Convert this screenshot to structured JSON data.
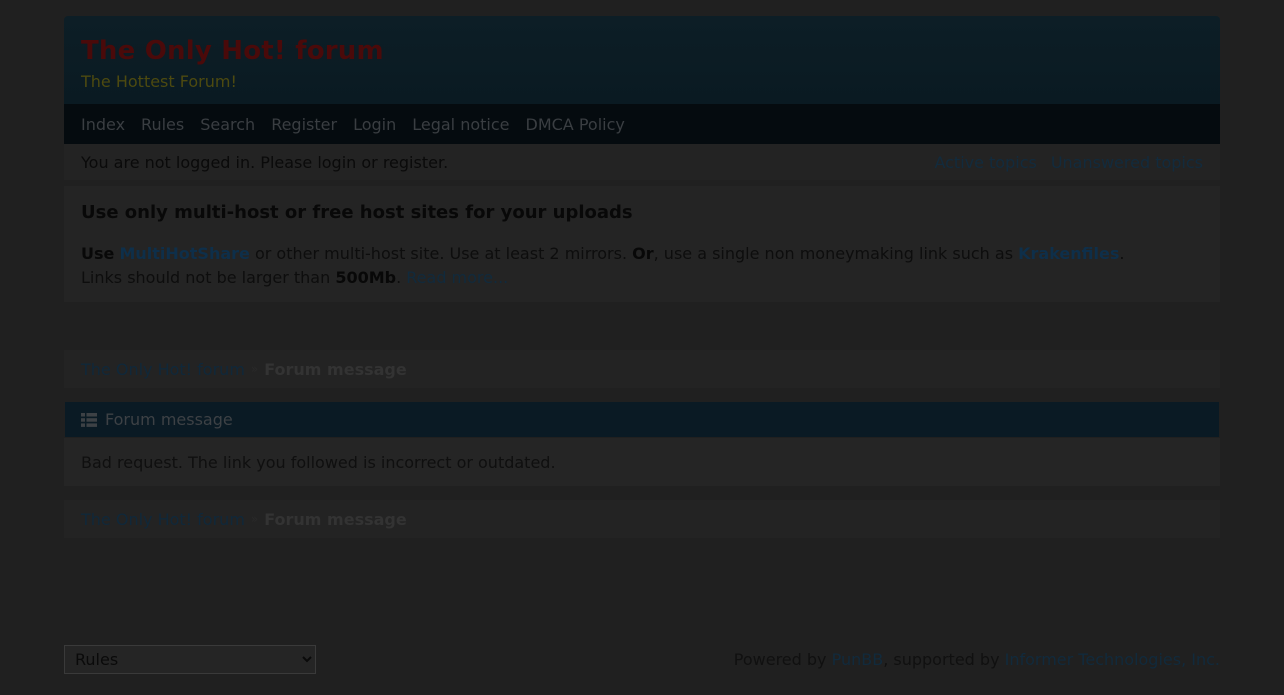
{
  "header": {
    "title": "The Only Hot! forum",
    "description": "The Hottest Forum!"
  },
  "nav": {
    "items": [
      "Index",
      "Rules",
      "Search",
      "Register",
      "Login",
      "Legal notice",
      "DMCA Policy"
    ]
  },
  "status": {
    "text": "You are not logged in. Please login or register.",
    "active_topics": "Active topics",
    "unanswered_topics": "Unanswered topics"
  },
  "announcement": {
    "title": "Use only multi-host or free host sites for your uploads",
    "use": "Use",
    "link1": "MultiHotShare",
    "part1": " or other multi-host site. Use at least 2 mirrors. ",
    "or": "Or",
    "part2": ", use a single non moneymaking link such as ",
    "link2": "Krakenfiles",
    "part3": ". Links should not be larger than ",
    "size": "500Mb",
    "part4": ". ",
    "read_more": "Read more..."
  },
  "breadcrumb": {
    "home": "The Only Hot! forum",
    "separator": "»",
    "current": "Forum message"
  },
  "message": {
    "title": "Forum message",
    "body": "Bad request. The link you followed is incorrect or outdated."
  },
  "footer": {
    "select_value": "Rules",
    "powered_by": "Powered by ",
    "punbb": "PunBB",
    "supported_by": ", supported by ",
    "informer": "Informer Technologies, Inc."
  },
  "colors": {
    "background": "#202020",
    "header": "#0d1e26",
    "navbar": "#050b0f",
    "link": "#122b3d"
  }
}
